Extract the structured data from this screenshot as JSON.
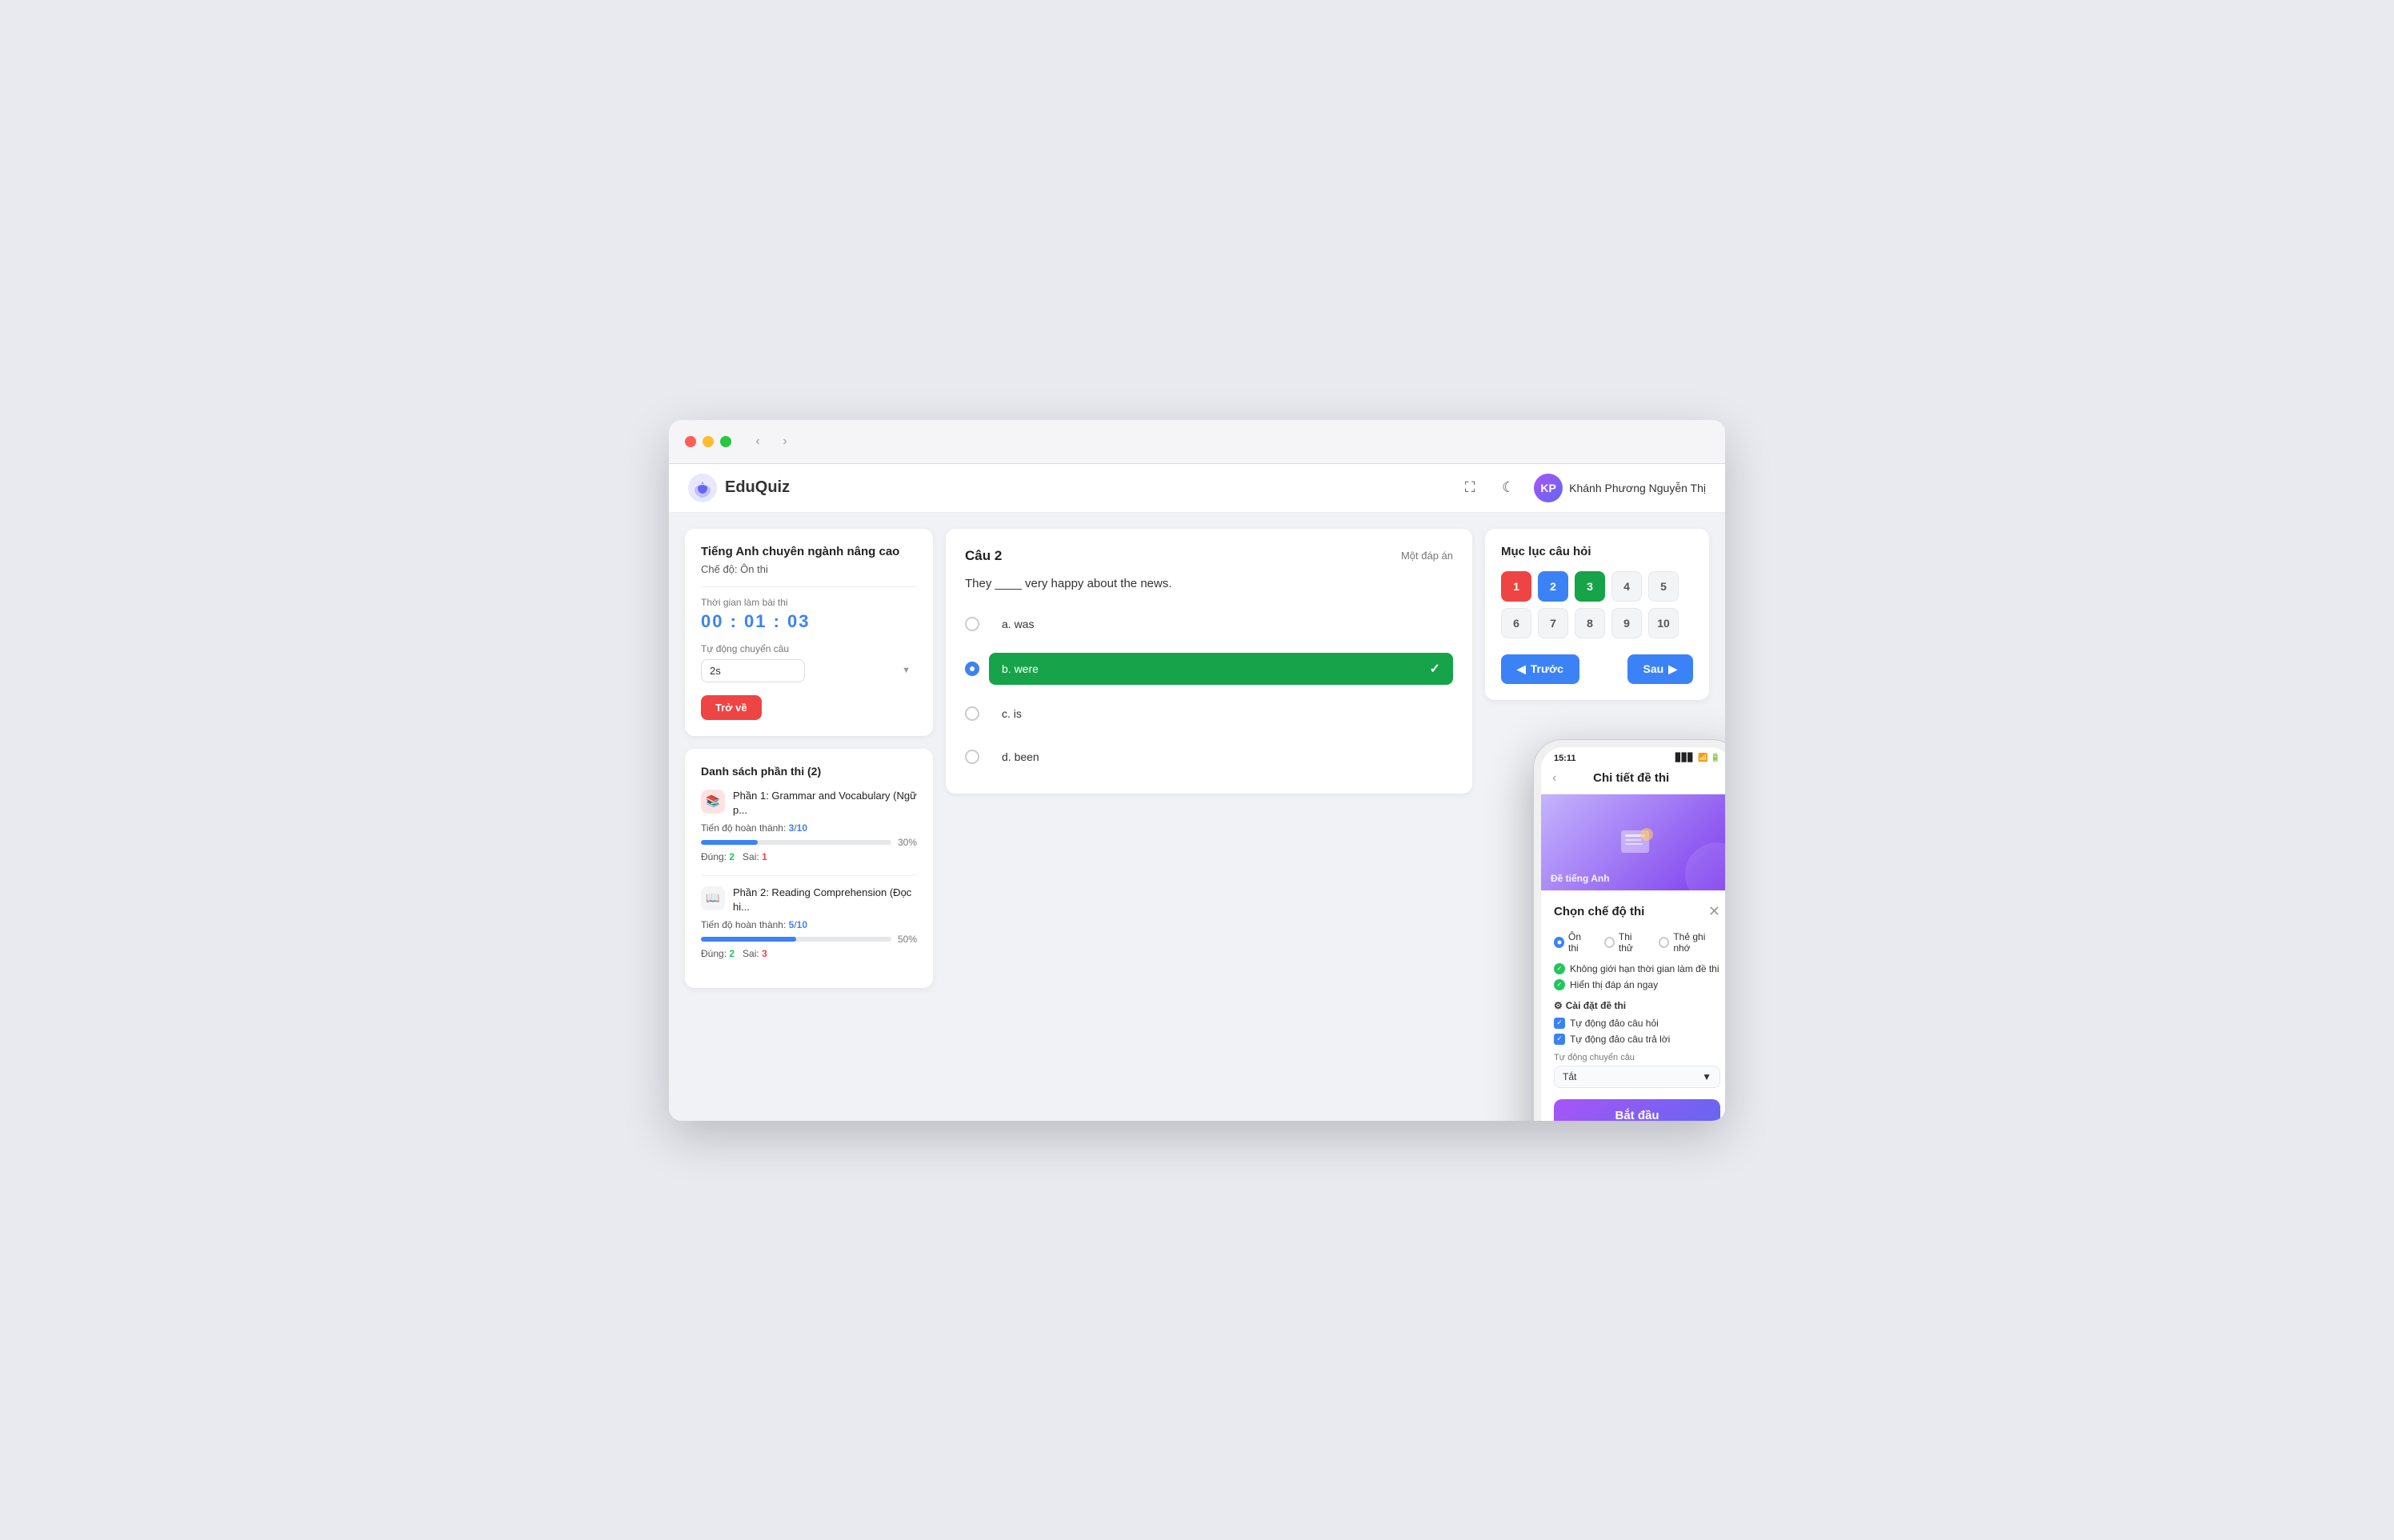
{
  "browser": {
    "traffic_lights": [
      "red",
      "yellow",
      "green"
    ],
    "back_arrow": "‹",
    "forward_arrow": "›"
  },
  "header": {
    "logo_text": "EduQuiz",
    "expand_icon": "⛶",
    "theme_icon": "☾",
    "user_name": "Khánh Phương Nguyễn Thị"
  },
  "left_panel": {
    "title": "Tiếng Anh chuyên ngành nâng cao",
    "mode_label": "Chế độ: Ôn thi",
    "timer_label": "Thời gian làm bài thi",
    "timer_value": "00 : 01 : 03",
    "auto_label": "Tự động chuyển câu",
    "auto_value": "2s",
    "back_button": "Trở về",
    "sections_title": "Danh sách phần thi (2)",
    "sections": [
      {
        "name": "Phần 1: Grammar and Vocabulary (Ngữ p...",
        "icon": "📚",
        "icon_type": "red",
        "progress_label": "Tiến độ hoàn thành:",
        "progress_current": "3",
        "progress_total": "10",
        "progress_pct": 30,
        "correct": 2,
        "wrong": 1,
        "correct_label": "Đúng:",
        "wrong_label": "Sai:"
      },
      {
        "name": "Phần 2: Reading Comprehension (Đọc hi...",
        "icon": "📖",
        "icon_type": "gray",
        "progress_label": "Tiến độ hoàn thành:",
        "progress_current": "5",
        "progress_total": "10",
        "progress_pct": 50,
        "correct": 2,
        "wrong": 3,
        "correct_label": "Đúng:",
        "wrong_label": "Sai:"
      }
    ]
  },
  "question_panel": {
    "question_number": "Câu 2",
    "answer_type": "Một đáp án",
    "question_text": "They ____ very happy about the news.",
    "options": [
      {
        "id": "a",
        "label": "a. was",
        "selected": false,
        "correct": false
      },
      {
        "id": "b",
        "label": "b. were",
        "selected": true,
        "correct": true
      },
      {
        "id": "c",
        "label": "c. is",
        "selected": false,
        "correct": false
      },
      {
        "id": "d",
        "label": "d. been",
        "selected": false,
        "correct": false
      }
    ]
  },
  "toc_panel": {
    "title": "Mục lục câu hỏi",
    "questions": [
      {
        "num": "1",
        "state": "current-wrong"
      },
      {
        "num": "2",
        "state": "answered"
      },
      {
        "num": "3",
        "state": "current-correct"
      },
      {
        "num": "4",
        "state": "unanswered"
      },
      {
        "num": "5",
        "state": "unanswered"
      },
      {
        "num": "6",
        "state": "unanswered"
      },
      {
        "num": "7",
        "state": "unanswered"
      },
      {
        "num": "8",
        "state": "unanswered"
      },
      {
        "num": "9",
        "state": "unanswered"
      },
      {
        "num": "10",
        "state": "unanswered"
      }
    ],
    "prev_button": "Trước",
    "next_button": "Sau"
  },
  "phone": {
    "time": "15:11",
    "screen_title": "Chi tiết đề thi",
    "banner_text": "Đề tiếng Anh",
    "modal_title": "Chọn chế độ thi",
    "close_icon": "✕",
    "modes": [
      {
        "label": "Ôn thi",
        "active": true
      },
      {
        "label": "Thi thử",
        "active": false
      },
      {
        "label": "Thẻ ghi nhớ",
        "active": false
      }
    ],
    "check_items": [
      "Không giới hạn thời gian làm đề thi",
      "Hiển thị đáp án ngay"
    ],
    "settings_title": "Cài đặt đề thi",
    "checkboxes": [
      "Tự động đảo câu hỏi",
      "Tự động đảo câu trả lời"
    ],
    "auto_switch_label": "Tự động chuyển câu",
    "auto_switch_value": "Tắt",
    "start_button": "Bắt đầu"
  }
}
